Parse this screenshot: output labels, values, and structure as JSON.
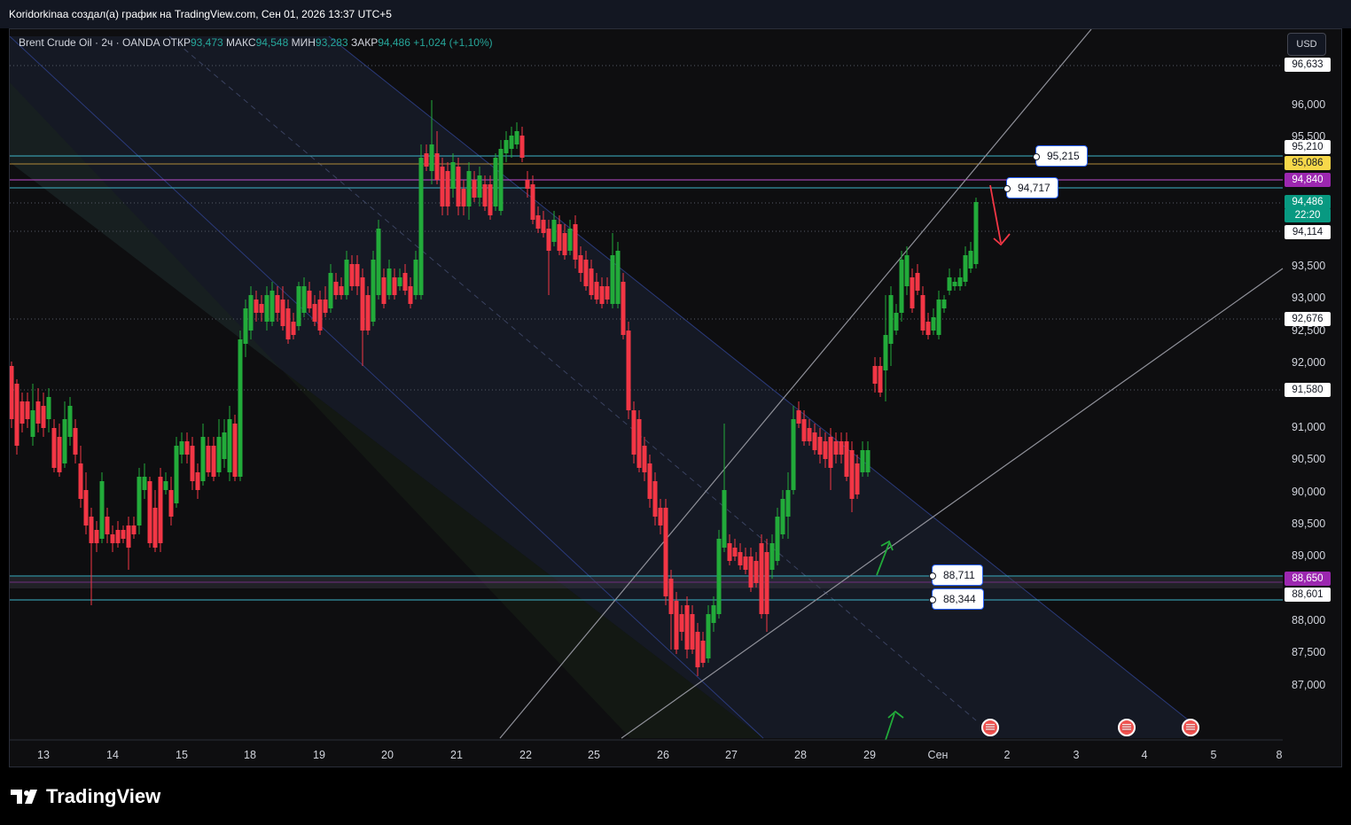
{
  "caption": "Koridorkinaa создал(а) график на TradingView.com, Сен 01, 2026 13:37 UTC+5",
  "symbol": {
    "name": "Brent Crude Oil · 2ч · OANDA",
    "open_label": "ОТКР",
    "open": "93,473",
    "high_label": "МАКС",
    "high": "94,548",
    "low_label": "МИН",
    "low": "93,283",
    "close_label": "ЗАКР",
    "close": "94,486",
    "change": "+1,024 (+1,10%)"
  },
  "currency_button": "USD",
  "y_axis_labels": [
    "96,000",
    "95,500",
    "93,500",
    "93,000",
    "92,500",
    "92,000",
    "91,000",
    "90,500",
    "90,000",
    "89,500",
    "89,000",
    "88,000",
    "87,500",
    "87,000"
  ],
  "x_axis_labels": [
    "13",
    "14",
    "15",
    "18",
    "19",
    "20",
    "21",
    "22",
    "25",
    "26",
    "27",
    "28",
    "29",
    "Сен",
    "2",
    "3",
    "4",
    "5",
    "8"
  ],
  "price_tags": [
    {
      "value": "96,633",
      "bg": "#ffffff",
      "fg": "#131722"
    },
    {
      "value": "95,210",
      "bg": "#ffffff",
      "fg": "#131722"
    },
    {
      "value": "95,086",
      "bg": "#f7d84a",
      "fg": "#131722"
    },
    {
      "value": "94,840",
      "bg": "#9c27b0",
      "fg": "#ffffff"
    },
    {
      "value": "94,486",
      "bg": "#089981",
      "fg": "#ffffff"
    },
    {
      "value": "22:20",
      "bg": "#089981",
      "fg": "#ffffff"
    },
    {
      "value": "94,114",
      "bg": "#ffffff",
      "fg": "#131722"
    },
    {
      "value": "92,676",
      "bg": "#ffffff",
      "fg": "#131722"
    },
    {
      "value": "91,580",
      "bg": "#ffffff",
      "fg": "#131722"
    },
    {
      "value": "88,650",
      "bg": "#9c27b0",
      "fg": "#ffffff"
    },
    {
      "value": "88,601",
      "bg": "#ffffff",
      "fg": "#131722"
    }
  ],
  "callouts": [
    "95,215",
    "94,717",
    "88,711",
    "88,344"
  ],
  "logo_text": "TradingView",
  "colors": {
    "up": "#22ab3a",
    "down": "#f23645",
    "cyan_line": "#3fb4c9",
    "purple_line": "#9c27b0",
    "channel": "#2a3a7a"
  }
}
